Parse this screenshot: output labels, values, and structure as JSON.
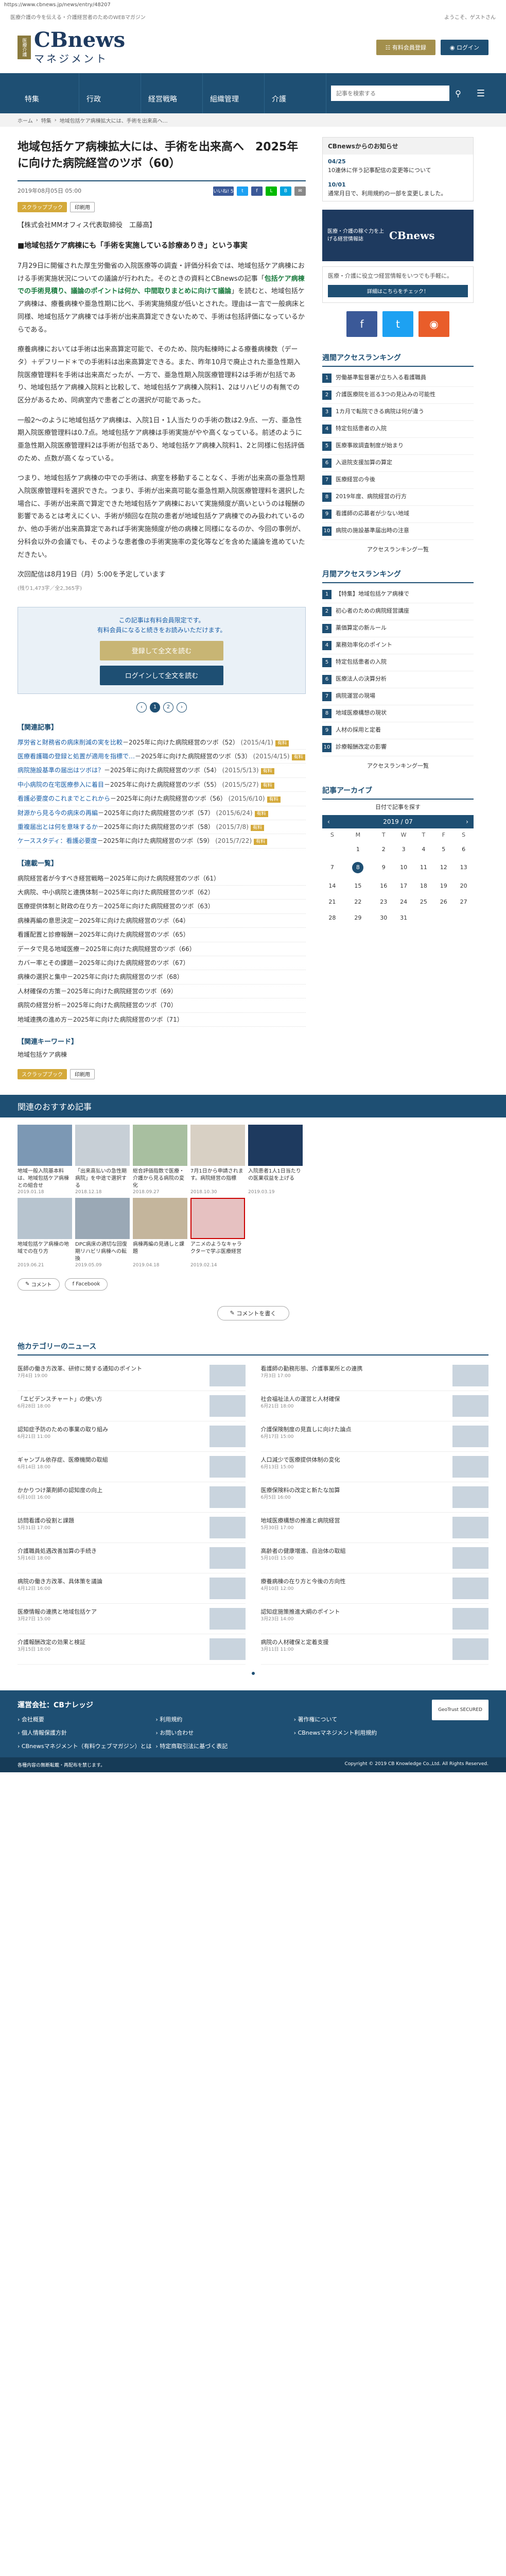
{
  "browser": {
    "url": "https://www.cbnews.jp/news/entry/48207"
  },
  "topstrip": {
    "left": "医療介護の今を伝える・介護経営者のためのWEBマガジン",
    "right": "ようこそ、ゲストさん"
  },
  "header": {
    "logo_mark": "医療介護",
    "logo_main": "CBnews",
    "logo_sub": "マネジメント",
    "buy_button": "有料会員登録",
    "login_button": "ログイン"
  },
  "nav": {
    "items": [
      "特集",
      "行政",
      "経営戦略",
      "組織管理",
      "介護"
    ],
    "search_placeholder": "記事を検索する"
  },
  "breadcrumb": [
    "ホーム",
    "特集",
    "地域包括ケア病棟拡大には、手術を出来高へ…"
  ],
  "article": {
    "title": "地域包括ケア病棟拡大には、手術を出来高へ　2025年に向けた病院経営のツボ（60）",
    "date": "2019年08月05日 05:00",
    "likes": "いいね! 5",
    "tags": [
      "スクラップブック",
      "印刷用"
    ],
    "author": "【株式会社MMオフィス代表取締役　工藤高】",
    "lead": "■地域包括ケア病棟にも「手術を実施している診療ありき」という事実",
    "p1_a": "7月29日に開催された厚生労働省の入院医療等の調査・評価分科会では、地域包括ケア病棟における手術実施状況についての議論が行われた。そのときの資料とCBnewsの記事「",
    "p1_hl": "包括ケア病棟での手術見積り、議論のポイントは何か、中間取りまとめに向けて議論",
    "p1_b": "」を読むと、地域包括ケア病棟は、療養病棟や亜急性期に比べ、手術実施頻度が低いとされた。理由は一言で一般病床と同様、地域包括ケア病棟では手術が出来高算定できないためで、手術は包括評価になっているからである。",
    "p2": "療養病棟においては手術は出来高算定可能で、そのため、院内転棟時による療養病棟数（データ）＋デフリード＊での手術料は出来高算定できる。また、昨年10月で廃止された亜急性期入院医療管理料を手術は出来高だったが、一方で、亜急性期入院医療管理料2は手術が包括であり、地域包括ケア病棟入院料と比較して、地域包括ケア病棟入院料1、2はリハビリの有無での区分があるため、同病室内で患者ごとの選択が可能であった。",
    "p3": "一般2〜のように地域包括ケア病棟は、入院1日・1人当たりの手術の数は2.9点、一方、亜急性期入院医療管理料は0.7点。地域包括ケア病棟は手術実施がやや高くなっている。前述のように亜急性期入院医療管理料2は手術が包括であり、地域包括ケア病棟入院料1、2と同様に包括評価のため、点数が高くなっている。",
    "p4": "つまり、地域包括ケア病棟の中での手術は、病室を移動することなく、手術が出来高の亜急性期入院医療管理料を選択できた。つまり、手術が出来高可能な亜急性期入院医療管理料を選択した場合に、手術が出来高で算定できた地域包括ケア病棟において実施頻度が高いというのは報酬の影響であるとは考えにくい、手術が頻回な在院の患者が地域包括ケア病棟でのみ扱われているのか、他の手術が出来高算定であれば手術実施頻度が他の病棟と同様になるのか、今回の事例が、分科会以外の会議でも、そのような患者像の手術実施率の変化等などを含めた議論を進めていただきたい。",
    "next": "次回配信は8月19日（月）5:00を予定しています",
    "charcount": "(残り1,473字／全2,365字)",
    "paywall_text": "この記事は有料会員限定です。\n有料会員になると続きをお読みいただけます。",
    "paywall_btn1": "登録して全文を読む",
    "paywall_btn2": "ログインして全文を読む",
    "pages": [
      "1",
      "2"
    ],
    "related_head": "【関連記事】",
    "related": [
      {
        "t": "厚労省と財務省の病床削減の実を比較",
        "s": "2025年に向けた病院経営のツボ（52）",
        "d": "2015/4/1"
      },
      {
        "t": "医療看護職の登録と処置が適用を指標で…",
        "s": "2025年に向けた病院経営のツボ（53）",
        "d": "2015/4/15"
      },
      {
        "t": "病院施設基準の届出はツボは？",
        "s": "2025年に向けた病院経営のツボ（54）",
        "d": "2015/5/13"
      },
      {
        "t": "中小病院の在宅医療参入に着目",
        "s": "2025年に向けた病院経営のツボ（55）",
        "d": "2015/5/27"
      },
      {
        "t": "看護必要度のこれまでとこれから",
        "s": "2025年に向けた病院経営のツボ（56）",
        "d": "2015/6/10"
      },
      {
        "t": "財源から見る今の病床の再編",
        "s": "2025年に向けた病院経営のツボ（57）",
        "d": "2015/6/24"
      },
      {
        "t": "重複届出とは何を意味するか",
        "s": "2025年に向けた病院経営のツボ（58）",
        "d": "2015/7/8"
      },
      {
        "t": "ケーススタディ：看護必要度",
        "s": "2025年に向けた病院経営のツボ（59）",
        "d": "2015/7/22"
      }
    ],
    "series_head": "【連載一覧】",
    "series": [
      "病院経営者が今すべき経営戦略－2025年に向けた病院経営のツボ（61）",
      "大病院、中小病院と連携体制－2025年に向けた病院経営のツボ（62）",
      "医療提供体制と財政の在り方－2025年に向けた病院経営のツボ（63）",
      "病棟再編の意思決定－2025年に向けた病院経営のツボ（64）",
      "看護配置と診療報酬－2025年に向けた病院経営のツボ（65）",
      "データで見る地域医療－2025年に向けた病院経営のツボ（66）",
      "カバー率とその課題－2025年に向けた病院経営のツボ（67）",
      "病棟の選択と集中－2025年に向けた病院経営のツボ（68）",
      "人材確保の方策－2025年に向けた病院経営のツボ（69）",
      "病院の経営分析－2025年に向けた病院経営のツボ（70）",
      "地域連携の進め方－2025年に向けた病院経営のツボ（71）"
    ],
    "keywords_head": "【関連キーワード】",
    "keywords": "地域包括ケア病棟"
  },
  "sidebar": {
    "news_head": "CBnewsからのお知らせ",
    "news": [
      {
        "d": "04/25",
        "t": "10連休に伴う記事配信の変更等について"
      },
      {
        "d": "10/01",
        "t": "通常月日で、利用規約の一部を変更しました。"
      }
    ],
    "ad1_small": "医療・介護の稼ぐ力を上げる経営情報誌",
    "ad1_big": "CBnews",
    "ad2_title": "医療・介護に役立つ経営情報をいつでも手軽に。",
    "ad2_btn": "詳細はこちらをチェック！",
    "rank_head": "週間アクセスランキング",
    "ranks": [
      "労働基準監督署が立ち入る看護職員",
      "介護医療院を巡る3つの見込みの可能性",
      "1カ月で転院できる病院は何が違う",
      "特定包括患者の入院",
      "医療事故調査制度が始まり",
      "入退院支援加算の算定",
      "医療経営の今後",
      "2019年度、病院経営の行方",
      "看護師の応募者が少ない地域",
      "病院の施設基準届出時の注意"
    ],
    "rank_more": "アクセスランキング一覧",
    "month_rank_head": "月間アクセスランキング",
    "month_ranks": [
      "【特集】地域包括ケア病棟で",
      "初心者のための病院経営講座",
      "薬価算定の新ルール",
      "業務効率化のポイント",
      "特定包括患者の入院",
      "医療法人の決算分析",
      "病院運営の現場",
      "地域医療構想の現状",
      "人材の採用と定着",
      "診療報酬改定の影響"
    ],
    "month_more": "アクセスランキング一覧",
    "archive_head": "記事アーカイブ",
    "archive_sub": "日付で記事を探す",
    "cal_month": "2019 / 07",
    "cal_days": [
      "S",
      "M",
      "T",
      "W",
      "T",
      "F",
      "S"
    ],
    "cal_rows": [
      [
        "",
        "1",
        "2",
        "3",
        "4",
        "5",
        "6"
      ],
      [
        "7",
        "8",
        "9",
        "10",
        "11",
        "12",
        "13"
      ],
      [
        "14",
        "15",
        "16",
        "17",
        "18",
        "19",
        "20"
      ],
      [
        "21",
        "22",
        "23",
        "24",
        "25",
        "26",
        "27"
      ],
      [
        "28",
        "29",
        "30",
        "31",
        "",
        "",
        ""
      ]
    ]
  },
  "recommended": {
    "title": "関連のおすすめ記事",
    "cards": [
      {
        "t": "地域一般入院基本料は、地域包括ケア病棟との組合せ",
        "d": "2019.01.18"
      },
      {
        "t": "「出来高払いの急性期病院」を中途で選択する",
        "d": "2018.12.18"
      },
      {
        "t": "総合評価指数で医療・介護から見る病院の変化",
        "d": "2018.09.27"
      },
      {
        "t": "7月1日から申請されます。病院経営の指標",
        "d": "2018.10.30"
      },
      {
        "t": "入院患者1人1日当たりの医業収益を上げる",
        "d": "2019.03.19"
      },
      {
        "t": "地域包括ケア病棟の地域での在り方",
        "d": "2019.06.21"
      },
      {
        "t": "DPC病床の適切な回復期リハビリ病棟への転換",
        "d": "2019.05.09"
      },
      {
        "t": "病棟再編の見通しと課題",
        "d": "2019.04.18"
      },
      {
        "t": "アニメのようなキャラクターで学ぶ医療経営",
        "d": "2019.02.14"
      }
    ],
    "comment": "コメント",
    "facebook": "Facebook",
    "comment_btn": "コメントを書く"
  },
  "other": {
    "head": "他カテゴリーのニュース",
    "items": [
      {
        "t": "医師の働き方改革、研修に関する通知のポイント",
        "d": "7月4日 19:00"
      },
      {
        "t": "看護師の勤務形態、介護事業所との連携",
        "d": "7月3日 17:00"
      },
      {
        "t": "「エビデンスチャート」の使い方",
        "d": "6月28日 18:00"
      },
      {
        "t": "社会福祉法人の運営と人材確保",
        "d": "6月21日 18:00"
      },
      {
        "t": "認知症予防のための事業の取り組み",
        "d": "6月21日 11:00"
      },
      {
        "t": "介護保険制度の見直しに向けた論点",
        "d": "6月17日 15:00"
      },
      {
        "t": "ギャンブル依存症、医療機関の取組",
        "d": "6月14日 18:00"
      },
      {
        "t": "人口減少で医療提供体制の変化",
        "d": "6月13日 15:00"
      },
      {
        "t": "かかりつけ薬剤師の認知度の向上",
        "d": "6月10日 16:00"
      },
      {
        "t": "医療保険料の改定と新たな加算",
        "d": "6月5日 16:00"
      },
      {
        "t": "訪問看護の役割と課題",
        "d": "5月31日 17:00"
      },
      {
        "t": "地域医療構想の推進と病院経営",
        "d": "5月30日 17:00"
      },
      {
        "t": "介護職員処遇改善加算の手続き",
        "d": "5月16日 18:00"
      },
      {
        "t": "高齢者の健康増進、自治体の取組",
        "d": "5月10日 15:00"
      },
      {
        "t": "病院の働き方改革、具体策を議論",
        "d": "4月12日 16:00"
      },
      {
        "t": "療養病棟の在り方と今後の方向性",
        "d": "4月10日 12:00"
      },
      {
        "t": "医療情報の連携と地域包括ケア",
        "d": "3月27日 15:00"
      },
      {
        "t": "認知症施策推進大綱のポイント",
        "d": "3月23日 14:00"
      },
      {
        "t": "介護報酬改定の効果と検証",
        "d": "3月15日 18:00"
      },
      {
        "t": "病院の人材確保と定着支援",
        "d": "3月11日 11:00"
      }
    ]
  },
  "footer": {
    "title": "運営会社：CBナレッジ",
    "links": [
      "会社概要",
      "利用規約",
      "著作権について",
      "個人情報保護方針",
      "お問い合わせ",
      "CBnewsマネジメント利用規約",
      "CBnewsマネジメント（有料ウェブマガジン）とは",
      "特定商取引法に基づく表記"
    ],
    "copyright": "Copyright © 2019 CB Knowledge Co.,Ltd. All Rights Reserved.",
    "note": "各種内容の無断転載・再配布を禁じます。",
    "geotrust": "GeoTrust SECURED"
  }
}
